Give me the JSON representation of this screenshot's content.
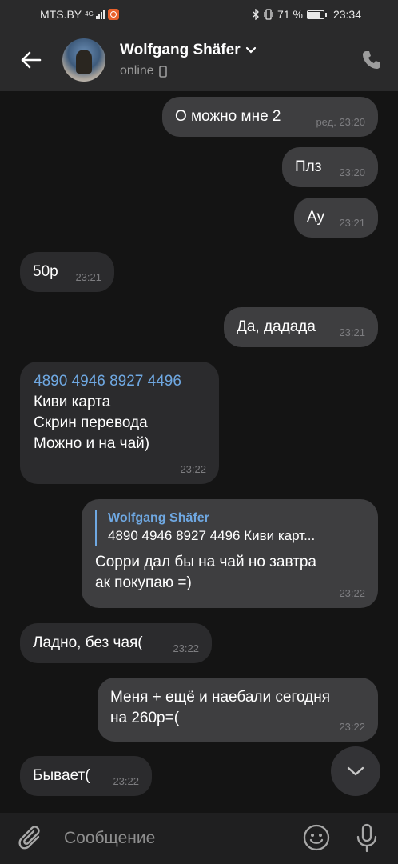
{
  "status_bar": {
    "carrier": "MTS.BY",
    "network": "4G",
    "battery": "71 %",
    "time": "23:34"
  },
  "header": {
    "name": "Wolfgang Shäfer",
    "status": "online"
  },
  "messages": [
    {
      "dir": "out",
      "text": "О можно мне 2",
      "edited": "ред.",
      "time": "23:20"
    },
    {
      "dir": "out",
      "text": "Плз",
      "time": "23:20"
    },
    {
      "dir": "out",
      "text": "Ау",
      "time": "23:21"
    },
    {
      "dir": "in",
      "text": "50р",
      "time": "23:21"
    },
    {
      "dir": "out",
      "text": "Да, дадада",
      "time": "23:21"
    },
    {
      "dir": "in",
      "link": "4890 4946 8927 4496",
      "lines": [
        "Киви карта",
        "Скрин перевода",
        "Можно и на чай)"
      ],
      "time": "23:22"
    },
    {
      "dir": "out",
      "reply_name": "Wolfgang Shäfer",
      "reply_text": "4890 4946 8927 4496 Киви карт...",
      "lines": [
        "Сорри дал бы на чай но завтра",
        "ак покупаю =)"
      ],
      "time": "23:22"
    },
    {
      "dir": "in",
      "text": "Ладно, без чая(",
      "time": "23:22"
    },
    {
      "dir": "out",
      "lines": [
        "Меня + ещё и наебали сегодня",
        "на 260р=("
      ],
      "time": "23:22"
    },
    {
      "dir": "in",
      "text": "Бывает(",
      "time": "23:22"
    }
  ],
  "composer": {
    "placeholder": "Сообщение"
  },
  "icons": {
    "back": "back-arrow-icon",
    "call": "phone-icon",
    "attach": "paperclip-icon",
    "emoji": "emoji-icon",
    "mic": "microphone-icon",
    "scroll": "chevron-down-icon"
  },
  "colors": {
    "background": "#141414",
    "bar": "#2a2a2b",
    "outgoing": "#3e3e40",
    "incoming": "#2b2b2d",
    "link": "#6fa8e2"
  }
}
